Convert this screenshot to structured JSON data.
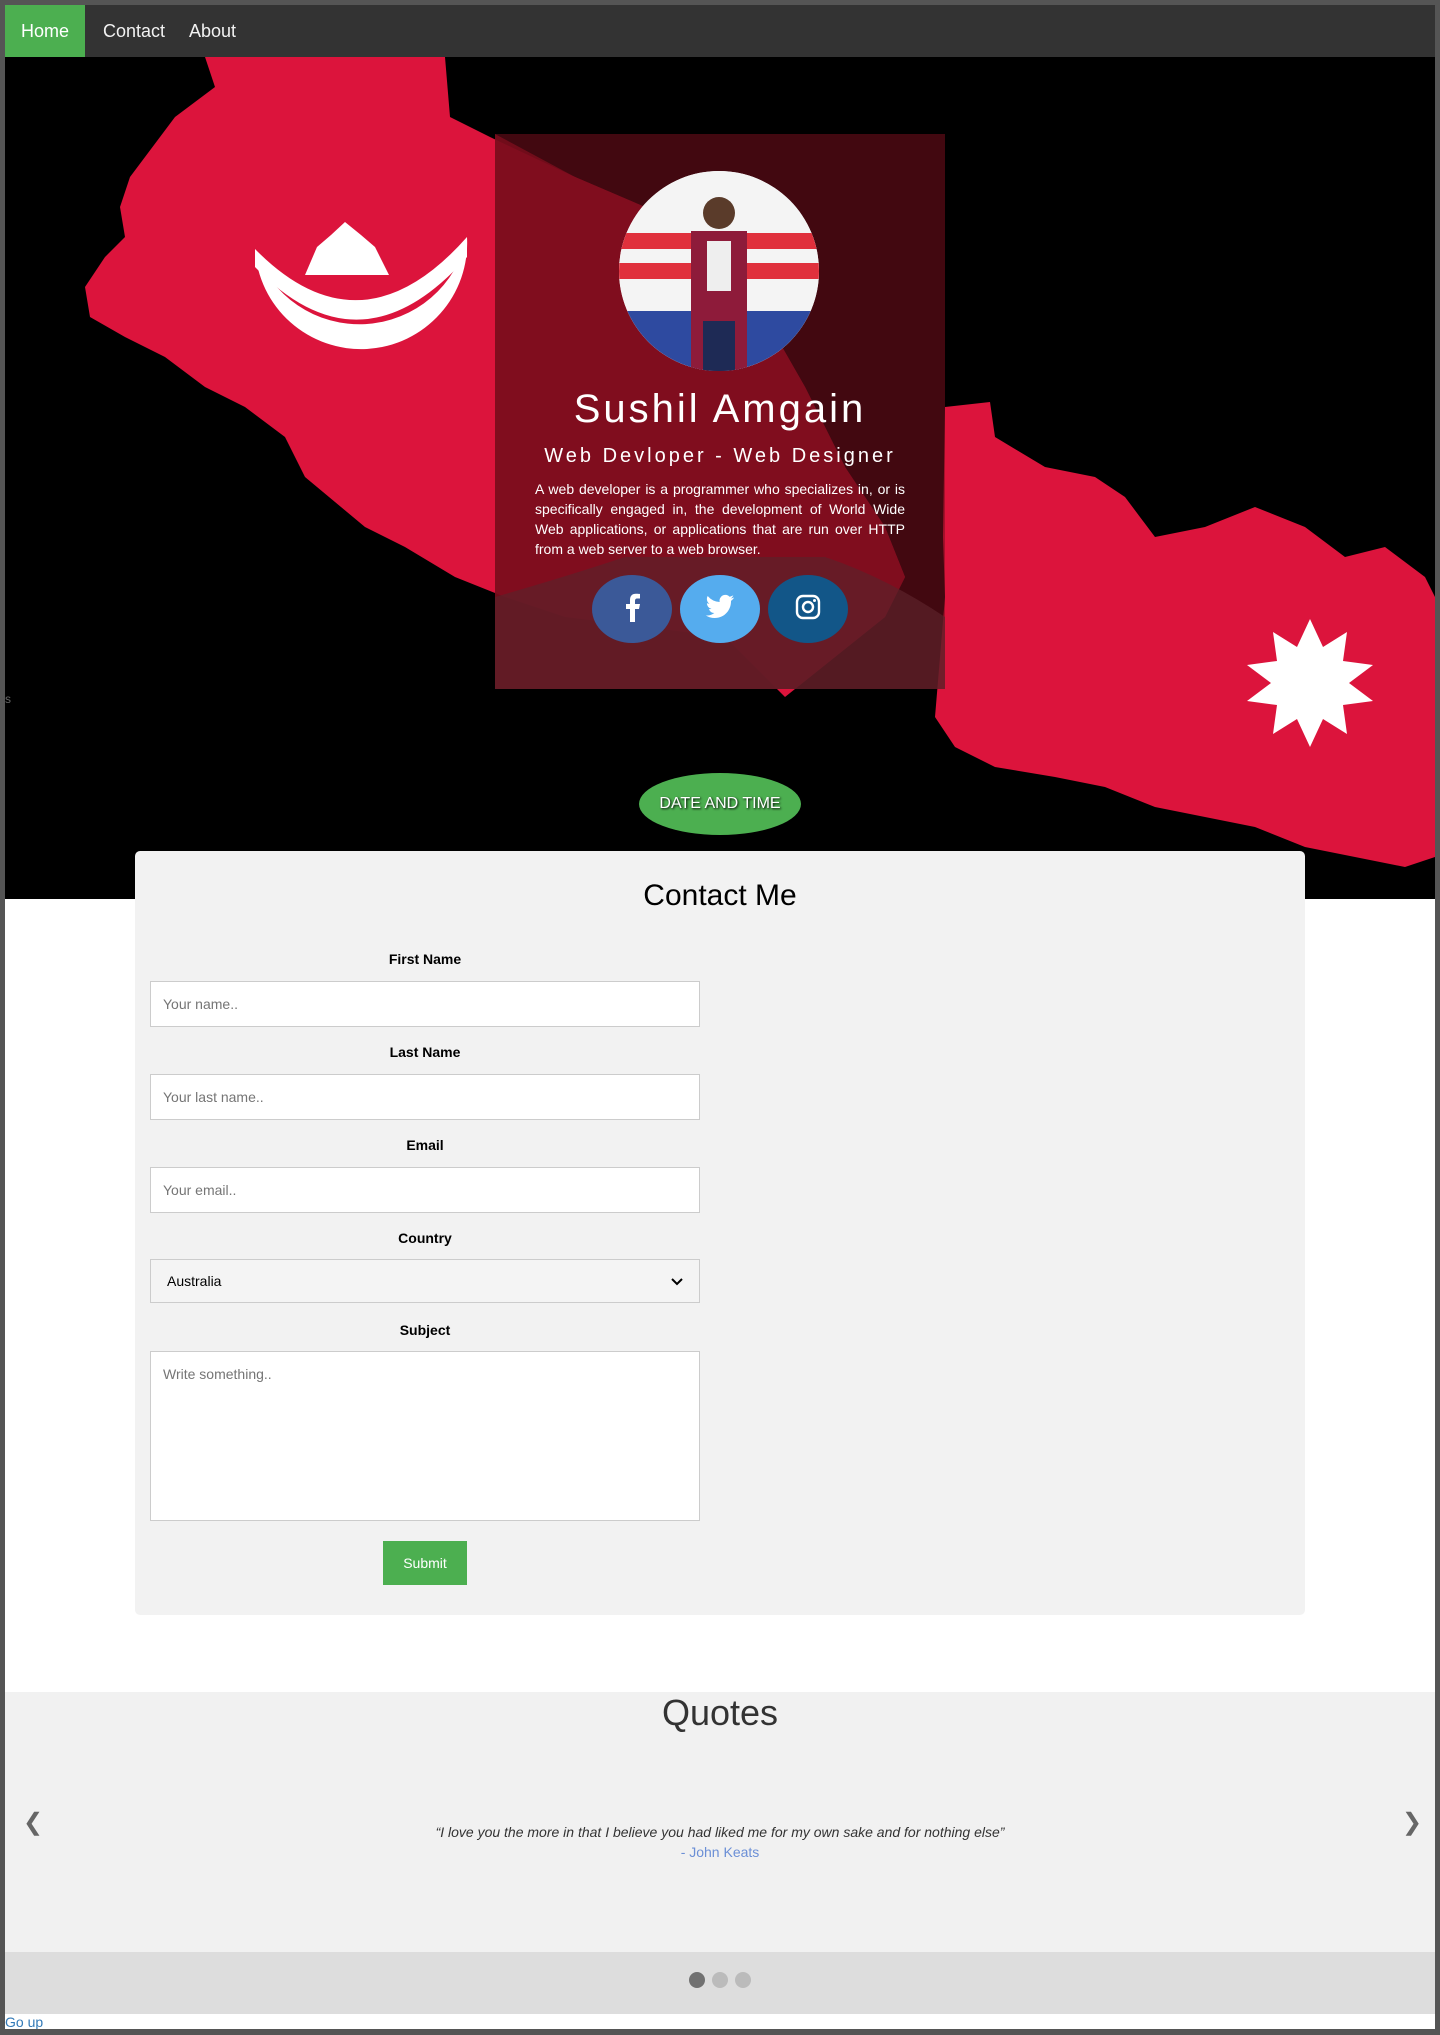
{
  "nav": {
    "items": [
      {
        "label": "Home",
        "active": true
      },
      {
        "label": "Contact",
        "active": false
      },
      {
        "label": "About",
        "active": false
      }
    ]
  },
  "hero": {
    "name": "Sushil Amgain",
    "role": "Web Devloper - Web Designer",
    "description": "A web developer is a programmer who specializes in, or is specifically engaged in, the development of World Wide Web applications, or applications that are run over HTTP from a web server to a web browser.",
    "social": [
      {
        "icon": "facebook-icon",
        "color": "#3b5998"
      },
      {
        "icon": "twitter-icon",
        "color": "#55acee"
      },
      {
        "icon": "instagram-icon",
        "color": "#125688"
      }
    ],
    "datetime_label": "DATE AND TIME",
    "stray_text": "s"
  },
  "contact": {
    "title": "Contact Me",
    "first_name_label": "First Name",
    "first_name_placeholder": "Your name..",
    "last_name_label": "Last Name",
    "last_name_placeholder": "Your last name..",
    "email_label": "Email",
    "email_placeholder": "Your email..",
    "country_label": "Country",
    "country_value": "Australia",
    "subject_label": "Subject",
    "subject_placeholder": "Write something..",
    "submit_label": "Submit"
  },
  "quotes": {
    "title": "Quotes",
    "prev_arrow": "❮",
    "next_arrow": "❯",
    "text": "“I love you the more in that I believe you had liked me for my own sake and for nothing else”",
    "author": "- John Keats",
    "dot_count": 3,
    "active_dot": 1
  },
  "footer": {
    "go_up": "Go up"
  },
  "colors": {
    "accent": "#4caf50",
    "flag_red": "#dc143c",
    "nav_bg": "#333333"
  }
}
